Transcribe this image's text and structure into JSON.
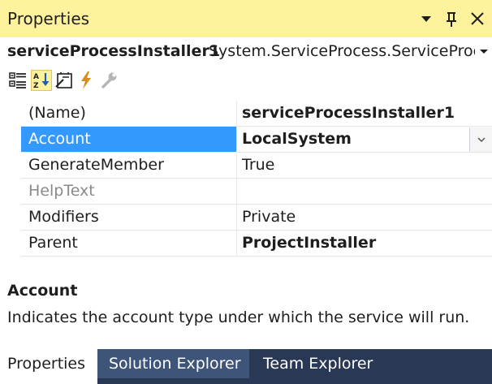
{
  "window": {
    "title": "Properties",
    "dropdown_glyph": "▾",
    "pin_glyph": "ㅍ",
    "close_glyph": "✕"
  },
  "object_selector": {
    "name": "serviceProcessInstaller1",
    "type": "System.ServiceProcess.ServiceProcessInstaller",
    "dropdown_glyph": "▾"
  },
  "toolbar": {
    "buttons": [
      {
        "icon": "categorized-icon",
        "active": false
      },
      {
        "icon": "alphabetical-icon",
        "active": true
      },
      {
        "icon": "properties-icon",
        "active": false
      },
      {
        "icon": "events-icon",
        "active": false
      },
      {
        "icon": "property-pages-icon",
        "active": false
      }
    ]
  },
  "properties": [
    {
      "name": "(Name)",
      "value": "serviceProcessInstaller1",
      "bold": true
    },
    {
      "name": "Account",
      "value": "LocalSystem",
      "bold": true,
      "selected": true,
      "has_dropdown": true
    },
    {
      "name": "GenerateMember",
      "value": "True"
    },
    {
      "name": "HelpText",
      "value": "",
      "disabled": true
    },
    {
      "name": "Modifiers",
      "value": "Private"
    },
    {
      "name": "Parent",
      "value": "ProjectInstaller",
      "bold": true
    }
  ],
  "value_dropdown_glyph": "⌵",
  "description": {
    "title": "Account",
    "text": "Indicates the account type under which the service will run."
  },
  "tabs": [
    {
      "label": "Properties",
      "active": true
    },
    {
      "label": "Solution Explorer"
    },
    {
      "label": "Team Explorer"
    }
  ],
  "colors": {
    "title_bar": "#fff29d",
    "selection": "#3399ff",
    "tab_strip": "#293955",
    "tab_inactive": "#3e5478"
  }
}
